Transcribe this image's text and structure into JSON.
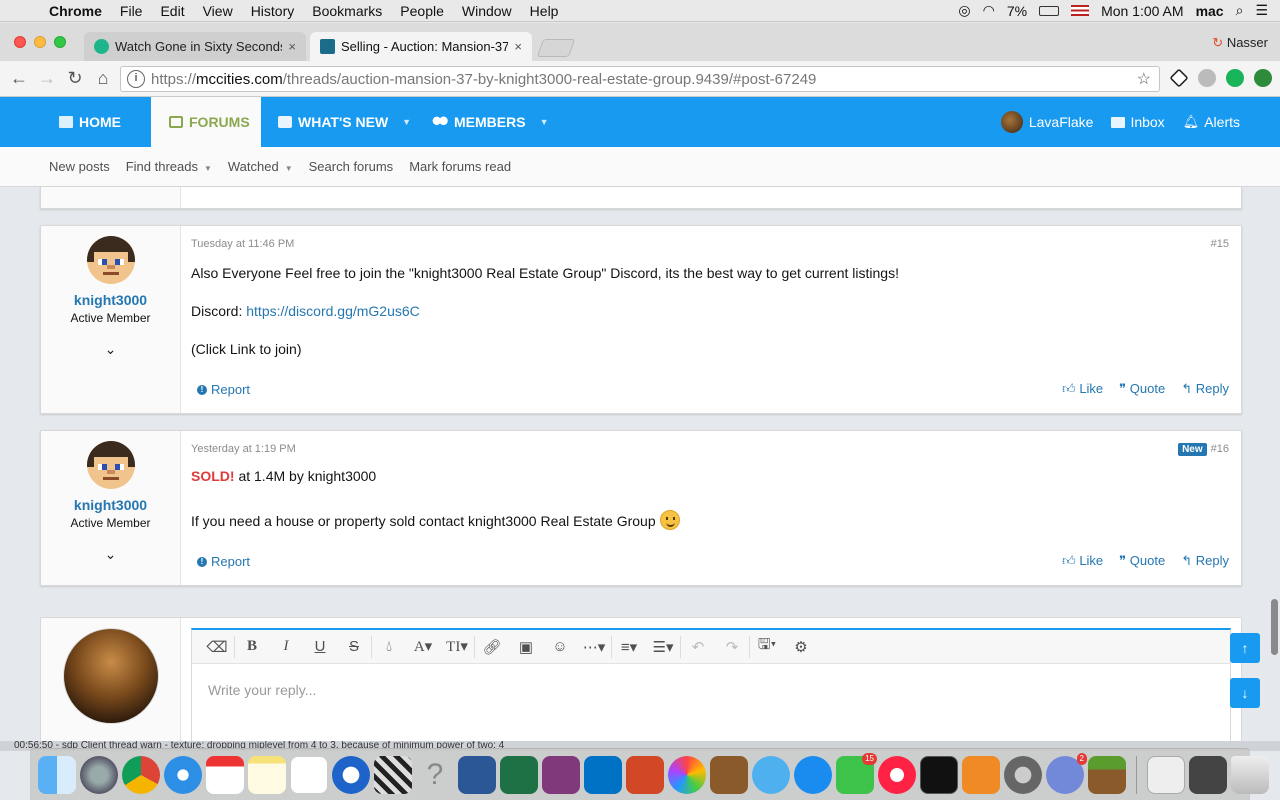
{
  "menubar": {
    "app": "Chrome",
    "items": [
      "File",
      "Edit",
      "View",
      "History",
      "Bookmarks",
      "People",
      "Window",
      "Help"
    ],
    "battery": "7%",
    "clock": "Mon 1:00 AM",
    "user": "mac"
  },
  "tabs": [
    {
      "title": "Watch Gone in Sixty Seconds",
      "close": "×",
      "active": false
    },
    {
      "title": "Selling - Auction: Mansion-37",
      "close": "×",
      "active": true
    }
  ],
  "profile_name": "Nasser",
  "url": {
    "proto": "https://",
    "host": "mccities.com",
    "path": "/threads/auction-mansion-37-by-knight3000-real-estate-group.9439/#post-67249"
  },
  "nav": {
    "home": "HOME",
    "forums": "FORUMS",
    "whats_new": "WHAT'S NEW",
    "members": "MEMBERS",
    "user": "LavaFlake",
    "inbox": "Inbox",
    "alerts": "Alerts"
  },
  "subnav": {
    "new_posts": "New posts",
    "find_threads": "Find threads",
    "watched": "Watched",
    "search_forums": "Search forums",
    "mark_read": "Mark forums read"
  },
  "posts": [
    {
      "date": "Tuesday at 11:46 PM",
      "num": "#15",
      "user": "knight3000",
      "title": "Active Member",
      "line1": "Also Everyone Feel free to join the \"knight3000 Real Estate Group\" Discord, its the best way to get current listings!",
      "discord_label": "Discord:",
      "discord_link": "https://discord.gg/mG2us6C",
      "line3": "(Click Link to join)"
    },
    {
      "date": "Yesterday at 1:19 PM",
      "new_badge": "New",
      "num": "#16",
      "user": "knight3000",
      "title": "Active Member",
      "sold": "SOLD!",
      "sold_rest": "at 1.4M by knight3000",
      "line2": "If you need a house or property sold contact knight3000 Real Estate Group"
    }
  ],
  "actions": {
    "report": "Report",
    "like": "Like",
    "quote": "Quote",
    "reply": "Reply"
  },
  "editor": {
    "placeholder": "Write your reply..."
  },
  "status_text": "00:56:50 - sdp          Client thread          warn - texture: dropping miplevel from 4 to 3, because of minimum power of two: 4",
  "dock_badges": {
    "facetime": "15",
    "discord": "2"
  }
}
